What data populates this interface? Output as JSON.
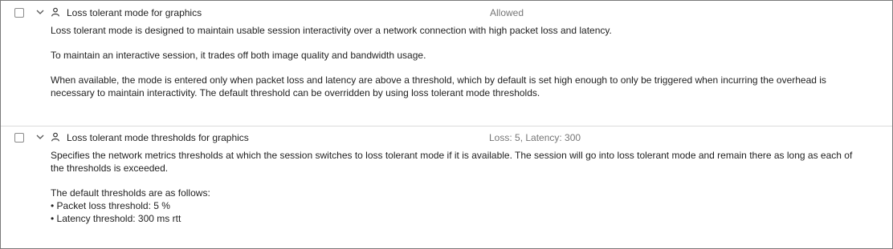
{
  "settings": [
    {
      "title": "Loss tolerant mode for graphics",
      "value": "Allowed",
      "paragraphs": [
        "Loss tolerant mode is designed to maintain usable session interactivity over a network connection with high packet loss and latency.",
        "To maintain an interactive session, it trades off both image quality and bandwidth usage.",
        "When available, the mode is entered only when packet loss and latency are above a threshold, which by default is set high enough to only be triggered when incurring the overhead is necessary to maintain interactivity. The default threshold can be overridden by using loss tolerant mode thresholds."
      ]
    },
    {
      "title": "Loss tolerant mode thresholds for graphics",
      "value": "Loss: 5, Latency: 300",
      "paragraphs": [
        "Specifies the network metrics thresholds at which the session switches to loss tolerant mode if it is available. The session will go into loss tolerant mode and remain there as long as each of the thresholds is exceeded.",
        "The default thresholds are as follows:"
      ],
      "bullets": [
        "• Packet loss threshold: 5 %",
        "• Latency threshold: 300 ms rtt"
      ]
    }
  ],
  "icons": {
    "checkbox": "checkbox-empty",
    "chevron": "chevron-down-icon",
    "user": "user-icon"
  },
  "colors": {
    "text": "#1f1f1f",
    "value_text": "#767676",
    "border": "#7a7a7a",
    "divider": "#dcdcdc"
  }
}
